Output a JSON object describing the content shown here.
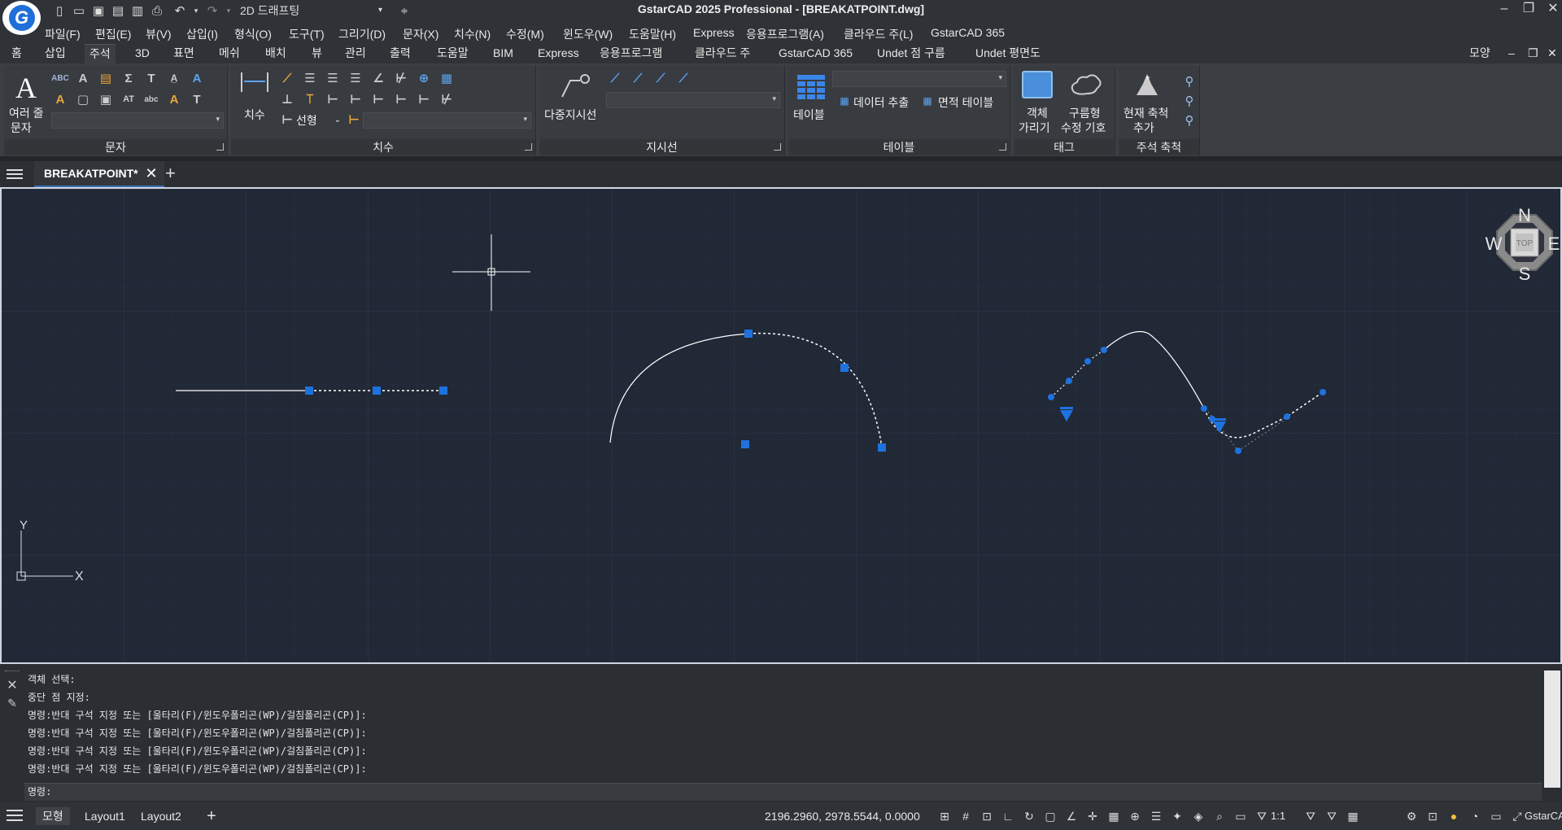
{
  "app": {
    "title": "GstarCAD 2025 Professional - [BREAKATPOINT.dwg]",
    "workspace": "2D 드래프팅",
    "colors": {
      "accent": "#1a6fd8",
      "canvas": "#212836",
      "grip": "#1e72e0"
    }
  },
  "menubar": [
    "파일(F)",
    "편집(E)",
    "뷰(V)",
    "삽입(I)",
    "형식(O)",
    "도구(T)",
    "그리기(D)",
    "문자(X)",
    "치수(N)",
    "수정(M)",
    "윈도우(W)",
    "도움말(H)",
    "Express",
    "응용프로그램(A)",
    "클라우드 주(L)",
    "GstarCAD 365"
  ],
  "ribbon_tabs": [
    "홈",
    "삽입",
    "주석",
    "3D",
    "표면",
    "메쉬",
    "배치",
    "뷰",
    "관리",
    "출력",
    "도움말",
    "BIM",
    "Express",
    "응용프로그램",
    "클라우드 주",
    "GstarCAD 365",
    "Undet 점 구름",
    "Undet 평면도"
  ],
  "ribbon_right": "모양",
  "panels": {
    "text": {
      "title": "문자",
      "big_btn_line1": "여러 줄",
      "big_btn_line2": "문자"
    },
    "dimension": {
      "title": "치수",
      "big_btn": "치수",
      "linear": "선형"
    },
    "leader": {
      "title": "지시선",
      "big_btn": "다중지시선"
    },
    "table": {
      "title": "테이블",
      "big_btn": "테이블",
      "data_extract": "데이터 추출",
      "area_table": "면적 테이블"
    },
    "tag": {
      "title": "태그",
      "btn1_line1": "객체",
      "btn1_line2": "가리기",
      "btn2_line1": "구름형",
      "btn2_line2": "수정 기호"
    },
    "scale": {
      "title": "주석 축척",
      "btn_line1": "현재 축척",
      "btn_line2": "추가"
    }
  },
  "doc_tab": "BREAKATPOINT*",
  "viewcube": {
    "n": "N",
    "s": "S",
    "e": "E",
    "w": "W",
    "face": "TOP"
  },
  "ucs": {
    "x": "X",
    "y": "Y"
  },
  "command_log": [
    "객체 선택:",
    "중단 점 지정:",
    "명령:반대 구석 지정 또는 [울타리(F)/윈도우폴리곤(WP)/걸침폴리곤(CP)]:",
    "명령:반대 구석 지정 또는 [울타리(F)/윈도우폴리곤(WP)/걸침폴리곤(CP)]:",
    "명령:반대 구석 지정 또는 [울타리(F)/윈도우폴리곤(WP)/걸침폴리곤(CP)]:",
    "명령:반대 구석 지정 또는 [울타리(F)/윈도우폴리곤(WP)/걸침폴리곤(CP)]:"
  ],
  "command_prompt": "명령:",
  "status": {
    "tabs": [
      "모형",
      "Layout1",
      "Layout2"
    ],
    "coords": "2196.2960, 2978.5544, 0.0000",
    "scale": "1:1",
    "brand": "GstarCAD"
  }
}
